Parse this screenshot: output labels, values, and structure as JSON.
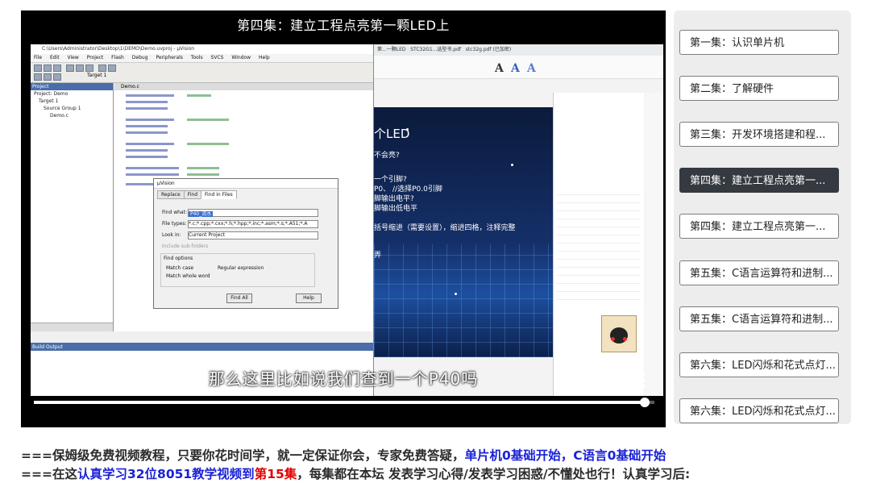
{
  "video": {
    "title": "第四集：建立工程点亮第一颗LED上",
    "subtitle": "那么这里比如说我们查到一个P40吗",
    "time": "34:00 / 34:31",
    "progress": 0.985
  },
  "ide": {
    "window_title": "C:\\Users\\Administrator\\Desktop\\1\\DEMO\\Demo.uvproj - µVision",
    "menu": [
      "File",
      "Edit",
      "View",
      "Project",
      "Flash",
      "Debug",
      "Peripherals",
      "Tools",
      "SVCS",
      "Window",
      "Help"
    ],
    "target": "Target 1",
    "project_header": "Project",
    "project_tree": [
      "Project: Demo",
      "Target 1",
      "Source Group 1",
      "Demo.c"
    ],
    "editor_tab": "Demo.c",
    "build_output": "Build Output",
    "find_dialog": {
      "title": "µVision",
      "tabs": [
        "Replace",
        "Find",
        "Find in Files"
      ],
      "find_what_label": "Find what:",
      "find_what_value": "P40_流水",
      "file_types_label": "File types:",
      "file_types_value": "*.c;*.cpp;*.cxx;*.h;*.hpp;*.inc;*.asm;*.s;*.A51;*.A",
      "look_in_label": "Look in:",
      "look_in_value": "Current Project",
      "include_sub": "Include sub-folders",
      "options_label": "Find options",
      "match_case": "Match case",
      "regex": "Regular expression",
      "whole_word": "Match whole word",
      "find_all": "Find All",
      "help": "Help"
    }
  },
  "ppt": {
    "tabs": [
      "第...一颗LED",
      "STC32G1...选型书.pdf",
      "stc32g.pdf (已加密)"
    ],
    "slide_lines": [
      "个LED",
      "不会亮?",
      "一个引脚?",
      "P0、    //选择P0.0引脚",
      "脚输出电平?",
      "脚输出低电平",
      "括号缩进（需要设置），缩进四格，注释完整",
      "弄"
    ]
  },
  "playlist": {
    "items": [
      {
        "label": "第一集：认识单片机",
        "active": false
      },
      {
        "label": "第二集：了解硬件",
        "active": false
      },
      {
        "label": "第三集：开发环境搭建和程...",
        "active": false
      },
      {
        "label": "第四集：建立工程点亮第一...",
        "active": true
      },
      {
        "label": "第四集：建立工程点亮第一...",
        "active": false
      },
      {
        "label": "第五集：C语言运算符和进制...",
        "active": false
      },
      {
        "label": "第五集：C语言运算符和进制...",
        "active": false
      },
      {
        "label": "第六集：LED闪烁和花式点灯...",
        "active": false
      },
      {
        "label": "第六集：LED闪烁和花式点灯...",
        "active": false
      }
    ]
  },
  "description": {
    "line1_prefix": "===保姆级免费视频教程，只要你花时间学，就一定保证你会，专家免费答疑，",
    "line1_blue": "单片机0基础开始，C语言0基础开始",
    "line2_prefix": "===在这",
    "line2_blue": "认真学习32位8051教学视频到",
    "line2_red": "第15集",
    "line2_suffix": "，每集都在本坛 发表学习心得/发表学习困惑/不懂处也行！认真学习后:"
  },
  "colors": {
    "active_item": "#343a40",
    "link_blue": "#1a22d6",
    "emphasis_red": "#e00000"
  }
}
